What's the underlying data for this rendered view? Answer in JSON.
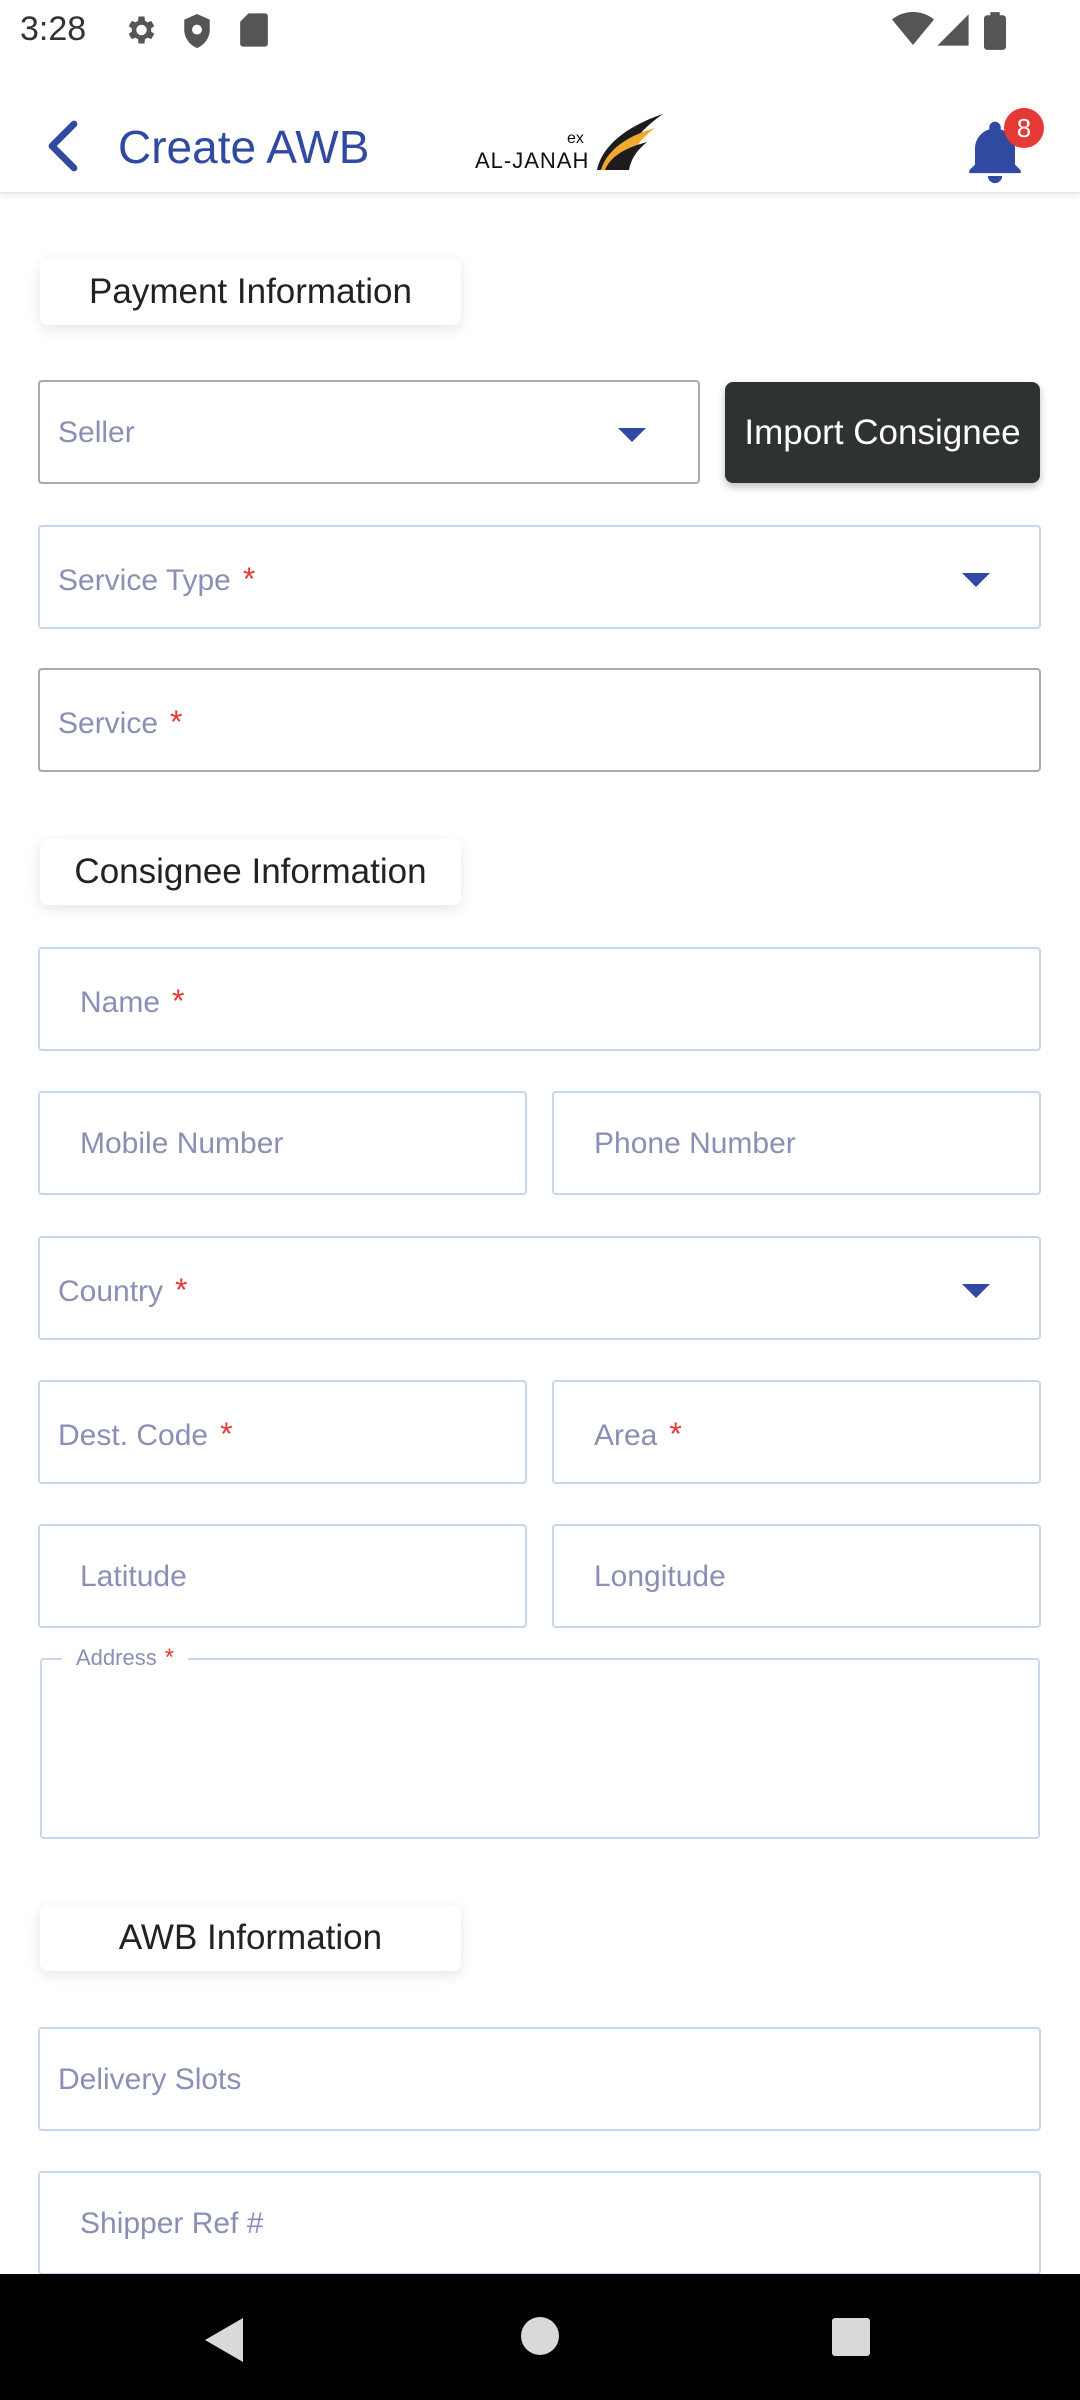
{
  "status_bar": {
    "time": "3:28"
  },
  "app_bar": {
    "title": "Create AWB",
    "logo_text": "AL-JANAH",
    "logo_superscript": "ex",
    "notification_count": "8"
  },
  "payment_section": {
    "title": "Payment Information",
    "seller_label": "Seller",
    "import_button": "Import Consignee",
    "service_type_label": "Service Type",
    "service_label": "Service"
  },
  "consignee_section": {
    "title": "Consignee Information",
    "name_label": "Name",
    "mobile_label": "Mobile Number",
    "phone_label": "Phone Number",
    "country_label": "Country",
    "dest_code_label": "Dest. Code",
    "area_label": "Area",
    "latitude_label": "Latitude",
    "longitude_label": "Longitude",
    "address_label": "Address"
  },
  "awb_section": {
    "title": "AWB Information",
    "delivery_slots_label": "Delivery Slots",
    "shipper_ref_label": "Shipper Ref #"
  },
  "required_mark": "*",
  "colors": {
    "accent": "#2f4aa0",
    "required": "#e53935",
    "button_dark": "#2f332f",
    "label": "#8a8fb5"
  }
}
